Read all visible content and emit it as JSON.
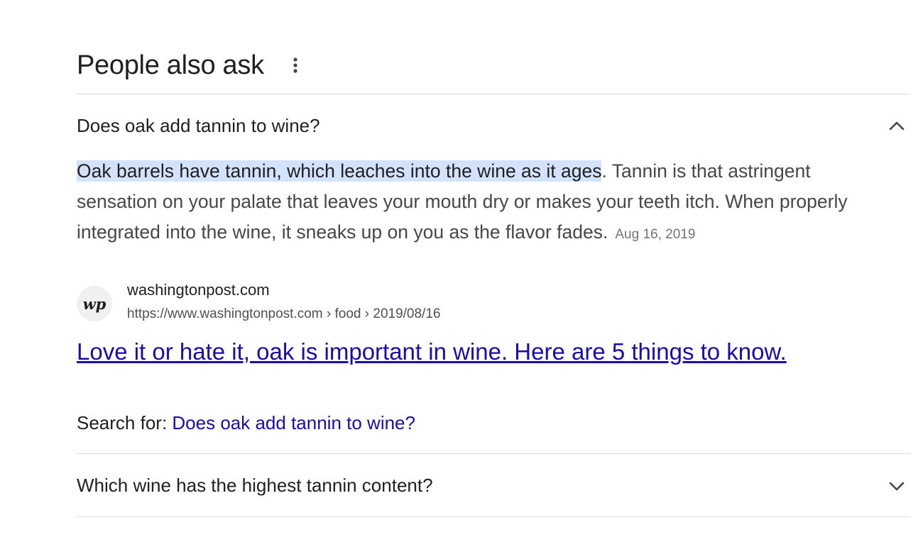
{
  "header": {
    "title": "People also ask",
    "more_icon": "more-vert-icon"
  },
  "questions": [
    {
      "text": "Does oak add tannin to wine?",
      "expanded": true,
      "icon": "chevron-up-icon"
    },
    {
      "text": "Which wine has the highest tannin content?",
      "expanded": false,
      "icon": "chevron-down-icon"
    }
  ],
  "answer": {
    "highlight": "Oak barrels have tannin, which leaches into the wine as it ages",
    "rest": ". Tannin is that astringent sensation on your palate that leaves your mouth dry or makes your teeth itch. When properly integrated into the wine, it sneaks up on you as the flavor fades.",
    "date": "Aug 16, 2019"
  },
  "source": {
    "favicon_text": "wp",
    "site_name": "washingtonpost.com",
    "url": "https://www.washingtonpost.com › food › 2019/08/16",
    "title": "Love it or hate it, oak is important in wine. Here are 5 things to know."
  },
  "search_for": {
    "label": "Search for: ",
    "query": "Does oak add tannin to wine?"
  },
  "colors": {
    "link": "#1a0dab",
    "highlight": "#d3e3fd",
    "divider": "#dadce0"
  }
}
